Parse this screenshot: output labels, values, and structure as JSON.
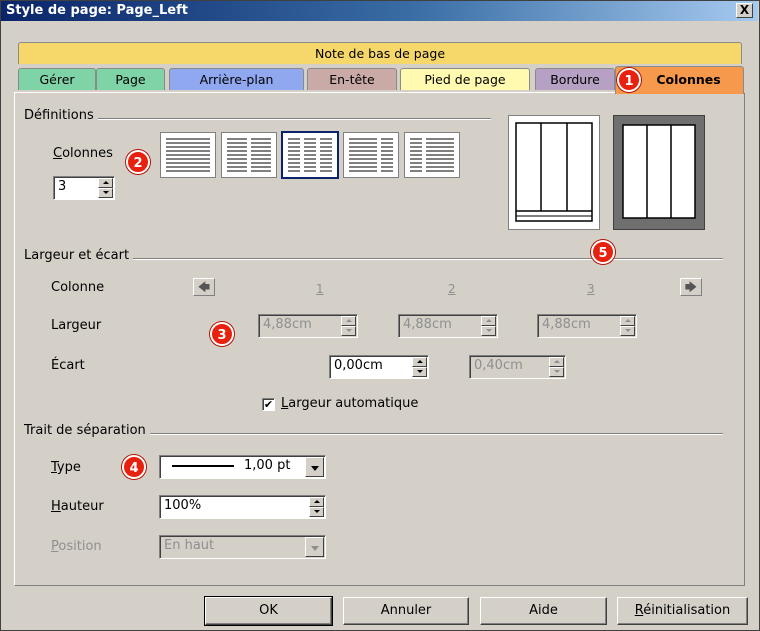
{
  "window": {
    "title": "Style de page: Page_Left",
    "close_label": "X"
  },
  "tabs_top": {
    "label": "Note de bas de page"
  },
  "tabs": [
    {
      "label": "Gérer",
      "color": "#7fd4a7"
    },
    {
      "label": "Page",
      "color": "#7fd4a7"
    },
    {
      "label": "Arrière-plan",
      "color": "#8fa8f0"
    },
    {
      "label": "En-tête",
      "color": "#c9aaa6"
    },
    {
      "label": "Pied de page",
      "color": "#fffab0"
    },
    {
      "label": "Bordure",
      "color": "#b6a0c4"
    },
    {
      "label": "Colonnes",
      "color": "#f7994d",
      "active": true
    }
  ],
  "definitions": {
    "title": "Définitions",
    "columns_label_prefix": "C",
    "columns_label_rest": "olonnes",
    "columns_value": "3",
    "layouts_count": 5,
    "selected_layout": 3
  },
  "width_spacing": {
    "title": "Largeur et écart",
    "column_label": "Colonne",
    "width_label": "Largeur",
    "spacing_label": "Écart",
    "col_numbers": [
      "1",
      "2",
      "3"
    ],
    "widths": [
      "4,88cm",
      "4,88cm",
      "4,88cm"
    ],
    "spacings": [
      "0,00cm",
      "0,40cm"
    ],
    "auto_width_prefix": "L",
    "auto_width_rest": "argeur automatique",
    "auto_width_checked": true,
    "left_arrow": "🡄",
    "right_arrow": "🡆"
  },
  "separator": {
    "title": "Trait de séparation",
    "type_label_prefix": "T",
    "type_label_rest": "ype",
    "type_value": "1,00 pt",
    "height_label_prefix": "H",
    "height_label_rest": "auteur",
    "height_value": "100%",
    "position_label_prefix": "P",
    "position_label_rest": "osition",
    "position_value": "En haut"
  },
  "badges": [
    "1",
    "2",
    "3",
    "4",
    "5"
  ],
  "buttons": {
    "ok": "OK",
    "cancel": "Annuler",
    "help": "Aide",
    "reset_prefix": "R",
    "reset_rest": "éinitialisation"
  },
  "colors": {
    "badge": "#e8200e",
    "title_bar": "#0a246a",
    "tab_top": "#f5d76a"
  }
}
